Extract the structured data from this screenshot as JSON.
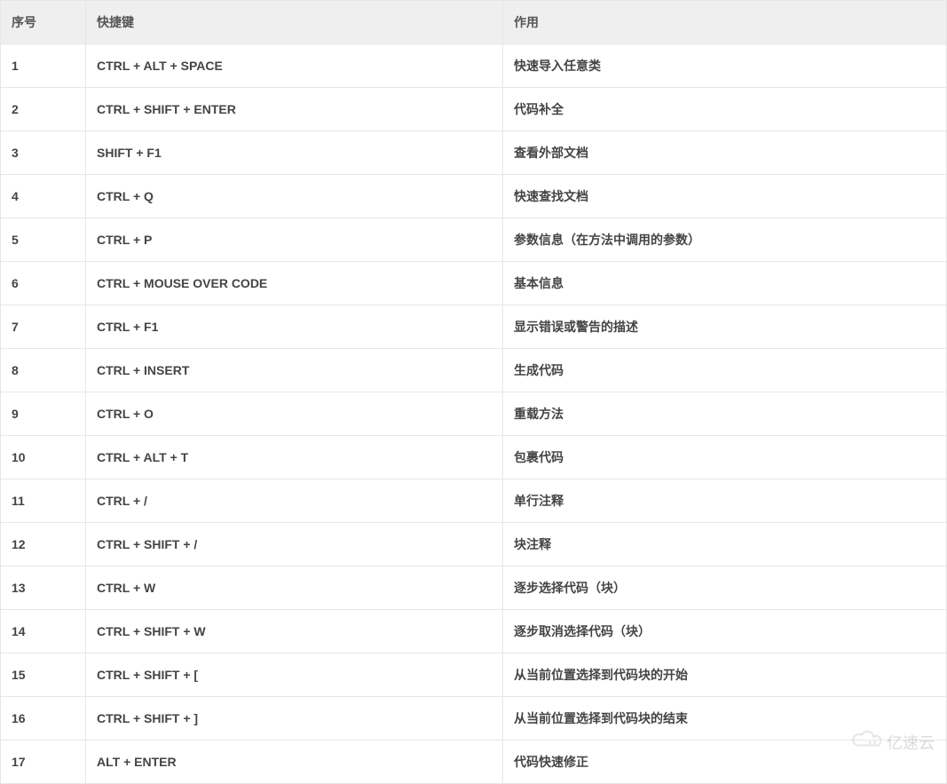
{
  "table": {
    "headers": {
      "index": "序号",
      "shortcut": "快捷键",
      "desc": "作用"
    },
    "rows": [
      {
        "index": "1",
        "shortcut": "CTRL + ALT + SPACE",
        "desc": "快速导入任意类"
      },
      {
        "index": "2",
        "shortcut": "CTRL + SHIFT + ENTER",
        "desc": "代码补全"
      },
      {
        "index": "3",
        "shortcut": "SHIFT + F1",
        "desc": "查看外部文档"
      },
      {
        "index": "4",
        "shortcut": "CTRL + Q",
        "desc": "快速查找文档"
      },
      {
        "index": "5",
        "shortcut": "CTRL + P",
        "desc": "参数信息（在方法中调用的参数）"
      },
      {
        "index": "6",
        "shortcut": "CTRL + MOUSE OVER CODE",
        "desc": "基本信息"
      },
      {
        "index": "7",
        "shortcut": "CTRL + F1",
        "desc": "显示错误或警告的描述"
      },
      {
        "index": "8",
        "shortcut": "CTRL + INSERT",
        "desc": "生成代码"
      },
      {
        "index": "9",
        "shortcut": "CTRL + O",
        "desc": "重载方法"
      },
      {
        "index": "10",
        "shortcut": "CTRL + ALT + T",
        "desc": "包裹代码"
      },
      {
        "index": "11",
        "shortcut": "CTRL + /",
        "desc": "单行注释"
      },
      {
        "index": "12",
        "shortcut": "CTRL + SHIFT + /",
        "desc": "块注释"
      },
      {
        "index": "13",
        "shortcut": "CTRL + W",
        "desc": "逐步选择代码（块）"
      },
      {
        "index": "14",
        "shortcut": "CTRL + SHIFT + W",
        "desc": "逐步取消选择代码（块）"
      },
      {
        "index": "15",
        "shortcut": "CTRL + SHIFT + [",
        "desc": "从当前位置选择到代码块的开始"
      },
      {
        "index": "16",
        "shortcut": "CTRL + SHIFT + ]",
        "desc": "从当前位置选择到代码块的结束"
      },
      {
        "index": "17",
        "shortcut": "ALT + ENTER",
        "desc": "代码快速修正"
      }
    ]
  },
  "watermark": {
    "text": "亿速云"
  }
}
